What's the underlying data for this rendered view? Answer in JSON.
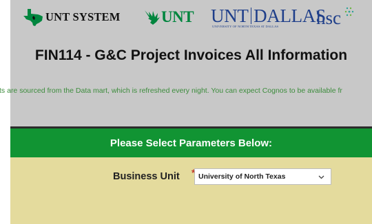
{
  "logos": {
    "unt_system": "UNT SYSTEM",
    "unt": "UNT",
    "unt_dallas": {
      "left": "UNT",
      "right": "DALLAS",
      "subtitle": "UNIVERSITY OF NORTH TEXAS AT DALLAS"
    },
    "hsc": "hsc"
  },
  "page": {
    "title": "FIN114 - G&C Project Invoices All Information",
    "notice": "eports are sourced from the Data mart, which is refreshed every night. You can expect Cognos to be available fr"
  },
  "parameters": {
    "header": "Please Select Parameters Below:",
    "business_unit": {
      "label": "Business Unit",
      "required_mark": "*",
      "selected": "University of North Texas"
    }
  },
  "colors": {
    "header_bg": "#c8c8c8",
    "brand_green": "#119433",
    "unt_green": "#00853e",
    "dallas_blue": "#1f3f8a",
    "param_bg": "#e4db9d",
    "notice_text": "#3c8c3c"
  },
  "icons": {
    "texas": "texas-map-icon",
    "eagle": "eagle-icon",
    "hsc_dots": "dots-icon",
    "dropdown": "chevron-down-icon"
  }
}
